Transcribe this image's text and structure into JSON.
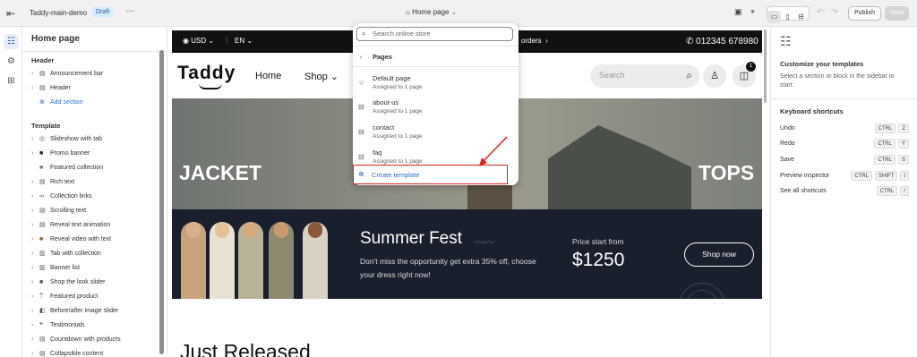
{
  "topbar": {
    "store_name": "Taddy-main-demo",
    "status_badge": "Draft",
    "more": "···",
    "page_selector": "Home page",
    "publish_label": "Publish",
    "save_label": "Save"
  },
  "sidebar": {
    "title": "Home page",
    "header_section": "Header",
    "header_items": [
      {
        "label": "Announcement bar"
      },
      {
        "label": "Header"
      }
    ],
    "add_section": "Add section",
    "template_section": "Template",
    "template_items": [
      {
        "label": "Slideshow with tab"
      },
      {
        "label": "Promo banner"
      },
      {
        "label": "Featured collection"
      },
      {
        "label": "Rich text"
      },
      {
        "label": "Collection links"
      },
      {
        "label": "Scrolling text"
      },
      {
        "label": "Reveal text animation"
      },
      {
        "label": "Reveal video with text"
      },
      {
        "label": "Tab with collection"
      },
      {
        "label": "Banner list"
      },
      {
        "label": "Shop the look slider"
      },
      {
        "label": "Featured product"
      },
      {
        "label": "Before/after image slider"
      },
      {
        "label": "Testimonials"
      },
      {
        "label": "Countdown with products"
      },
      {
        "label": "Collapsible content"
      }
    ]
  },
  "preview": {
    "announcement": {
      "currency": "USD",
      "language": "EN",
      "orders_text": "orders",
      "phone": "012345 678980"
    },
    "header": {
      "logo": "Taddy",
      "nav": [
        "Home",
        "Shop"
      ],
      "search_placeholder": "Search",
      "cart_count": "1"
    },
    "hero": {
      "left_label": "JACKET",
      "right_label": "TOPS"
    },
    "promo": {
      "title": "Summer Fest",
      "body": "Don't miss the opportunity get extra 35% off, choose your dress right now!",
      "price_label": "Price start from",
      "price": "$1250",
      "button": "Shop now"
    },
    "section_heading": "Just Released"
  },
  "dropdown": {
    "search_placeholder": "Search online store",
    "group_label": "Pages",
    "items": [
      {
        "title": "Default page",
        "subtitle": "Assigned to 1 page"
      },
      {
        "title": "about-us",
        "subtitle": "Assigned to 1 page"
      },
      {
        "title": "contact",
        "subtitle": "Assigned to 1 page"
      },
      {
        "title": "faq",
        "subtitle": "Assigned to 1 page"
      }
    ],
    "create_label": "Create template"
  },
  "right_panel": {
    "title": "Customize your templates",
    "description": "Select a section or block in the sidebar to start.",
    "shortcuts_title": "Keyboard shortcuts",
    "shortcuts": [
      {
        "label": "Undo",
        "keys": [
          "CTRL",
          "Z"
        ]
      },
      {
        "label": "Redo",
        "keys": [
          "CTRL",
          "Y"
        ]
      },
      {
        "label": "Save",
        "keys": [
          "CTRL",
          "S"
        ]
      },
      {
        "label": "Preview inspector",
        "keys": [
          "CTRL",
          "SHIFT",
          "I"
        ]
      },
      {
        "label": "See all shortcuts",
        "keys": [
          "CTRL",
          "/"
        ]
      }
    ]
  }
}
